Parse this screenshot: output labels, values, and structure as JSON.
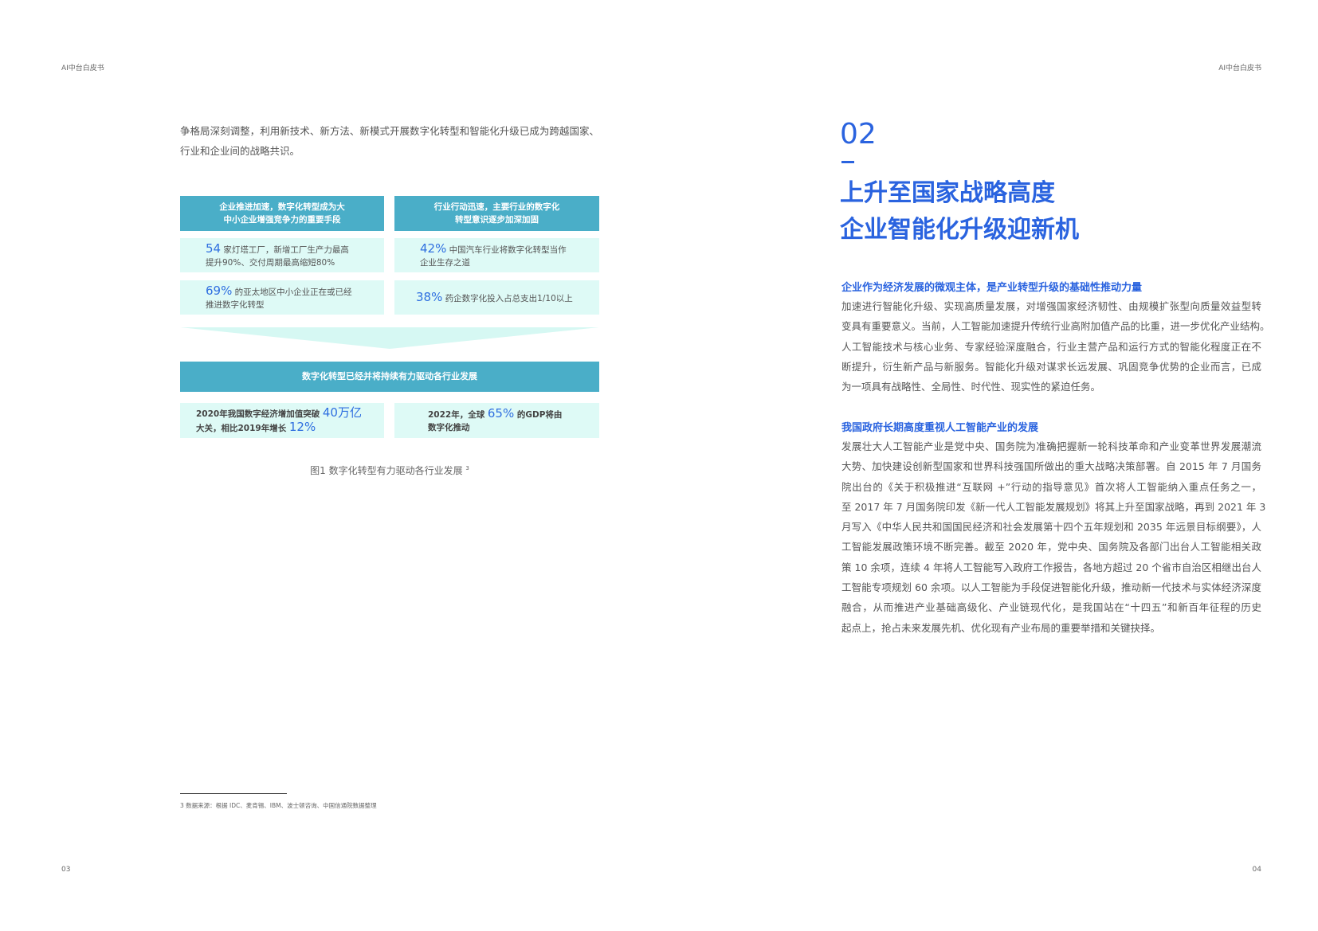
{
  "header": {
    "left": "AI中台白皮书",
    "right": "AI中台白皮书"
  },
  "left_page": {
    "intro_lines": [
      "争格局深刻调整，利用新技术、新方法、新模式开展数字化转型和智能化升级已成为跨越国家、",
      "行业和企业间的战略共识。"
    ],
    "figure": {
      "col1_header": [
        "企业推进加速，数字化转型成为大",
        "中小企业增强竞争力的重要手段"
      ],
      "col2_header": [
        "行业行动迅速，主要行业的数字化",
        "转型意识逐步加深加固"
      ],
      "c1r1": {
        "num": "54",
        "text1": " 家灯塔工厂，新增工厂生产力最高",
        "text2": "提升90%、交付周期最高缩短80%"
      },
      "c2r1": {
        "num": "42%",
        "text1": " 中国汽车行业将数字化转型当作",
        "text2": "企业生存之道"
      },
      "c1r2": {
        "num": "69%",
        "text1": " 的亚太地区中小企业正在或已经",
        "text2": "推进数字化转型"
      },
      "c2r2": {
        "num": "38%",
        "text1": " 药企数字化投入占总支出1/10以上"
      },
      "banner": "数字化转型已经并将持续有力驱动各行业发展",
      "b1": {
        "t1": "2020年我国数字经济增加值突破 ",
        "n1": "40万亿",
        "t2": "大关，相比2019年增长 ",
        "n2": "12%"
      },
      "b2": {
        "t1": "2022年，全球 ",
        "n1": "65%",
        "t2": " 的GDP将由",
        "t3": "数字化推动"
      },
      "caption": "图1 数字化转型有力驱动各行业发展 ",
      "caption_ref": "3"
    },
    "footnote": "3 数据来源：根据 IDC、麦肯锡、IBM、波士顿咨询、中国信通院数据整理",
    "page_number": "03"
  },
  "right_page": {
    "section_number": "02",
    "title_lines": [
      "上升至国家战略高度",
      "企业智能化升级迎新机"
    ],
    "sub1": "企业作为经济发展的微观主体，是产业转型升级的基础性推动力量",
    "para1": [
      "加速进行智能化升级、实现高质量发展，对增强国家经济韧性、由规模扩张型向质量效益型转",
      "变具有重要意义。当前，人工智能加速提升传统行业高附加值产品的比重，进一步优化产业结构。",
      "人工智能技术与核心业务、专家经验深度融合，行业主营产品和运行方式的智能化程度正在不",
      "断提升，衍生新产品与新服务。智能化升级对谋求长远发展、巩固竞争优势的企业而言，已成",
      "为一项具有战略性、全局性、时代性、现实性的紧迫任务。"
    ],
    "sub2": "我国政府长期高度重视人工智能产业的发展",
    "para2": [
      "发展壮大人工智能产业是党中央、国务院为准确把握新一轮科技革命和产业变革世界发展潮流",
      "大势、加快建设创新型国家和世界科技强国所做出的重大战略决策部署。自 2015 年 7 月国务",
      "院出台的《关于积极推进“互联网 +”行动的指导意见》首次将人工智能纳入重点任务之一，",
      "至 2017 年 7 月国务院印发《新一代人工智能发展规划》将其上升至国家战略，再到 2021 年 3",
      "月写入《中华人民共和国国民经济和社会发展第十四个五年规划和 2035 年远景目标纲要》，人",
      "工智能发展政策环境不断完善。截至 2020 年，党中央、国务院及各部门出台人工智能相关政",
      "策 10 余项，连续 4 年将人工智能写入政府工作报告，各地方超过 20 个省市自治区相继出台人",
      "工智能专项规划 60 余项。以人工智能为手段促进智能化升级，推动新一代技术与实体经济深度",
      "融合，从而推进产业基础高级化、产业链现代化，是我国站在“十四五”和新百年征程的历史",
      "起点上，抢占未来发展先机、优化现有产业布局的重要举措和关键抉择。"
    ],
    "page_number": "04"
  },
  "colors": {
    "accent": "#2a63df",
    "box_header": "#4aaec8",
    "box_light": "#defaf6"
  }
}
